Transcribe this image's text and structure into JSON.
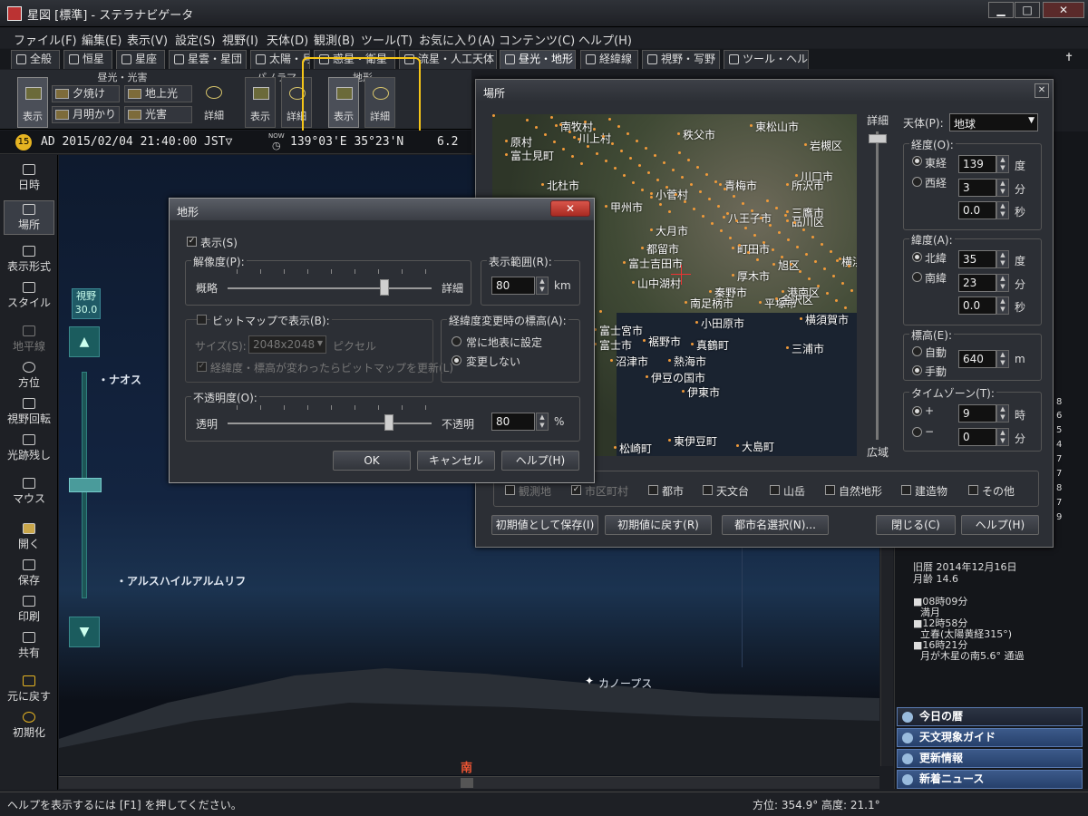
{
  "window": {
    "title": "星図 [標準] - ステラナビゲータ",
    "min": "▁",
    "max": "□",
    "close": "✕"
  },
  "menu": [
    "ファイル(F)",
    "編集(E)",
    "表示(V)",
    "設定(S)",
    "視野(I)",
    "天体(D)",
    "観測(B)",
    "ツール(T)",
    "お気に入り(A)",
    "コンテンツ(C)",
    "ヘルプ(H)"
  ],
  "tabs": [
    "全般",
    "恒星",
    "星座",
    "星雲・星団",
    "太陽・月",
    "惑星・衛星",
    "流星・人工天体",
    "昼光・地形",
    "経緯線",
    "視野・写野",
    "ツール・ヘルプ"
  ],
  "ribbon": {
    "groups": [
      "昼光・光害",
      "パノラマ",
      "地形"
    ],
    "daylight_show": "表示",
    "yuyake": "夕焼け",
    "chijoko": "地上光",
    "meimei": "月明かり",
    "kogai": "光害",
    "detail": "詳細",
    "pano_show": "表示",
    "pano_detail": "詳細",
    "terrain_show": "表示",
    "terrain_detail": "詳細"
  },
  "datebar": {
    "date": "AD 2015/02/04 21:40:00 JST▽",
    "now": "NOW",
    "coord": "139°03'E 35°23'N",
    "mag": "6.2"
  },
  "lefttools": [
    "日時",
    "場所",
    "表示形式",
    "スタイル",
    "地平線",
    "方位",
    "視野回転",
    "光跡残し",
    "マウス",
    "開く",
    "保存",
    "印刷",
    "共有",
    "元に戻す",
    "初期化"
  ],
  "zoom": {
    "label": "視野",
    "value": "30.0",
    "up": "▲",
    "down": "▼"
  },
  "sky_labels": {
    "naos": "・ナオス",
    "alsuhail": "・アルスハイルアルムリフ",
    "canopus": "カノープス",
    "south": "南"
  },
  "rightpanel": {
    "kyureki": "旧暦 2014年12月16日",
    "getsurei": "月齢 14.6",
    "events": [
      "■08時09分",
      "満月",
      "■12時58分",
      "立春(太陽黄経315°)",
      "■16時21分",
      "月が木星の南5.6° 通過"
    ],
    "right_numbers": [
      "8",
      "6",
      "5",
      "4",
      "7",
      "7",
      "8",
      "7",
      "9"
    ],
    "buttons": [
      "今日の暦",
      "天文現象ガイド",
      "更新情報",
      "新着ニュース"
    ]
  },
  "status": {
    "help": "ヘルプを表示するには [F1] を押してください。",
    "coords": "方位: 354.9° 高度:  21.1°"
  },
  "terrain_dialog": {
    "title": "地形",
    "show": "表示(S)",
    "resolution": "解像度(P):",
    "coarse": "概略",
    "fine": "詳細",
    "range": "表示範囲(R):",
    "range_val": "80",
    "km": "km",
    "bitmap": "ビットマップで表示(B):",
    "size": "サイズ(S):",
    "size_val": "2048x2048",
    "pixel": "ピクセル",
    "bitmap_update": "経緯度・標高が変わったらビットマップを更新(L)",
    "elev_change": "経緯度変更時の標高(A):",
    "opt1": "常に地表に設定",
    "opt2": "変更しない",
    "opacity": "不透明度(O):",
    "transparent": "透明",
    "opaque": "不透明",
    "opacity_val": "80",
    "percent": "%",
    "ok": "OK",
    "cancel": "キャンセル",
    "help": "ヘルプ(H)"
  },
  "place_dialog": {
    "title": "場所",
    "detail": "詳細",
    "wide": "広域",
    "body_label": "天体(P):",
    "body_val": "地球",
    "lon_label": "経度(O):",
    "east": "東経",
    "west": "西経",
    "lon_deg": "139",
    "lon_min": "3",
    "lon_sec": "0.0",
    "deg": "度",
    "min": "分",
    "sec": "秒",
    "lat_label": "緯度(A):",
    "north": "北緯",
    "south": "南緯",
    "lat_deg": "35",
    "lat_min": "23",
    "lat_sec": "0.0",
    "elev_label": "標高(E):",
    "auto": "自動",
    "manual": "手動",
    "elev_val": "640",
    "m": "m",
    "tz_label": "タイムゾーン(T):",
    "plus": "+",
    "minus": "−",
    "tz_h": "9",
    "tz_m": "0",
    "hour": "時",
    "minute": "分",
    "layers": [
      "観測地",
      "市区町村",
      "都市",
      "天文台",
      "山岳",
      "自然地形",
      "建造物",
      "その他"
    ],
    "save_default": "初期値として保存(I)",
    "restore_default": "初期値に戻す(R)",
    "city_select": "都市名選択(N)...",
    "close": "閉じる(C)",
    "help": "ヘルプ(H)",
    "cities": [
      "南牧村",
      "原村",
      "川上村",
      "富士見町",
      "秩父市",
      "東松山市",
      "北杜市",
      "甲州市",
      "小菅村",
      "青梅市",
      "所沢市",
      "大月市",
      "八王子市",
      "三鷹市",
      "都留市",
      "町田市",
      "富士吉田市",
      "山中湖村",
      "厚木市",
      "横浜市",
      "秦野市",
      "南足柄市",
      "平塚市",
      "富士宮市",
      "小田原市",
      "富士市",
      "裾野市",
      "真鶴町",
      "沼津市",
      "熱海市",
      "伊豆の国市",
      "伊東市",
      "三浦市",
      "松崎町",
      "東伊豆町",
      "大島町",
      "港南区",
      "金沢区",
      "横須賀市",
      "旭区",
      "品川区",
      "川口市",
      "岩槻区"
    ]
  }
}
